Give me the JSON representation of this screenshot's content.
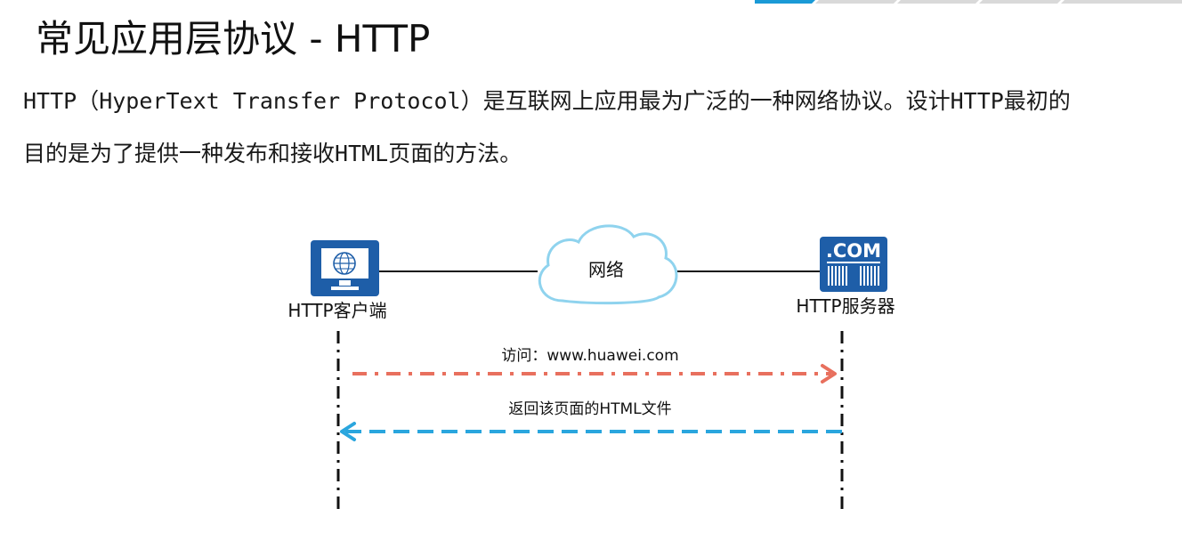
{
  "title": "常见应用层协议 - HTTP",
  "description": {
    "line1": "HTTP（HyperText Transfer Protocol）是互联网上应用最为广泛的一种网络协议。设计HTTP最初的",
    "line2": "目的是为了提供一种发布和接收HTML页面的方法。"
  },
  "diagram": {
    "client_label": "HTTP客户端",
    "server_label": "HTTP服务器",
    "network_label": "网络",
    "server_badge": ".COM",
    "request_label": "访问：www.huawei.com",
    "response_label": "返回该页面的HTML文件"
  },
  "colors": {
    "icon_blue": "#1e5ea8",
    "request_arrow": "#e8705e",
    "response_arrow": "#2aa6de",
    "cloud_stroke": "#8fd3ee",
    "top_bar_accent": "#1a9ad6",
    "top_bar_gray": "#d9d9d9"
  },
  "icons": {
    "client": "monitor-globe-icon",
    "server": "server-com-icon",
    "network": "cloud-icon"
  }
}
